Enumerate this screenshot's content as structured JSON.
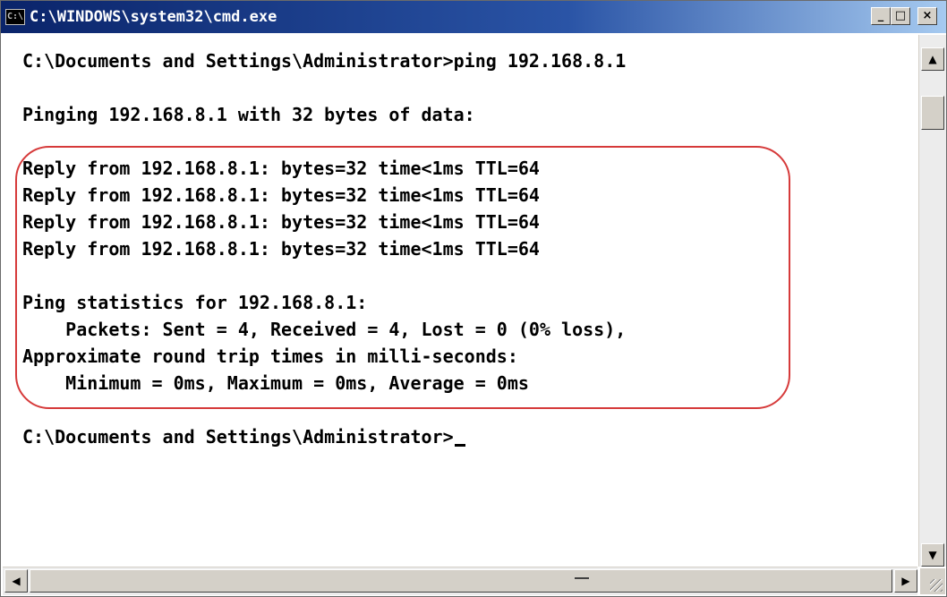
{
  "window": {
    "title": "C:\\WINDOWS\\system32\\cmd.exe",
    "icon": "cmd-icon",
    "buttons": {
      "minimize": "_",
      "maximize": "□",
      "close": "×"
    }
  },
  "console": {
    "lines": [
      "C:\\Documents and Settings\\Administrator>ping 192.168.8.1",
      "",
      "Pinging 192.168.8.1 with 32 bytes of data:",
      "",
      "Reply from 192.168.8.1: bytes=32 time<1ms TTL=64",
      "Reply from 192.168.8.1: bytes=32 time<1ms TTL=64",
      "Reply from 192.168.8.1: bytes=32 time<1ms TTL=64",
      "Reply from 192.168.8.1: bytes=32 time<1ms TTL=64",
      "",
      "Ping statistics for 192.168.8.1:",
      "    Packets: Sent = 4, Received = 4, Lost = 0 (0% loss),",
      "Approximate round trip times in milli-seconds:",
      "    Minimum = 0ms, Maximum = 0ms, Average = 0ms",
      "",
      "C:\\Documents and Settings\\Administrator>"
    ]
  },
  "scrollbars": {
    "up_arrow": "▲",
    "down_arrow": "▼",
    "left_arrow": "◀",
    "right_arrow": "▶"
  },
  "colors": {
    "titlebar_start": "#0a246a",
    "titlebar_end": "#a6caf0",
    "highlight_outline": "#d63a3a",
    "console_text": "#000000",
    "console_background": "#ffffff"
  }
}
